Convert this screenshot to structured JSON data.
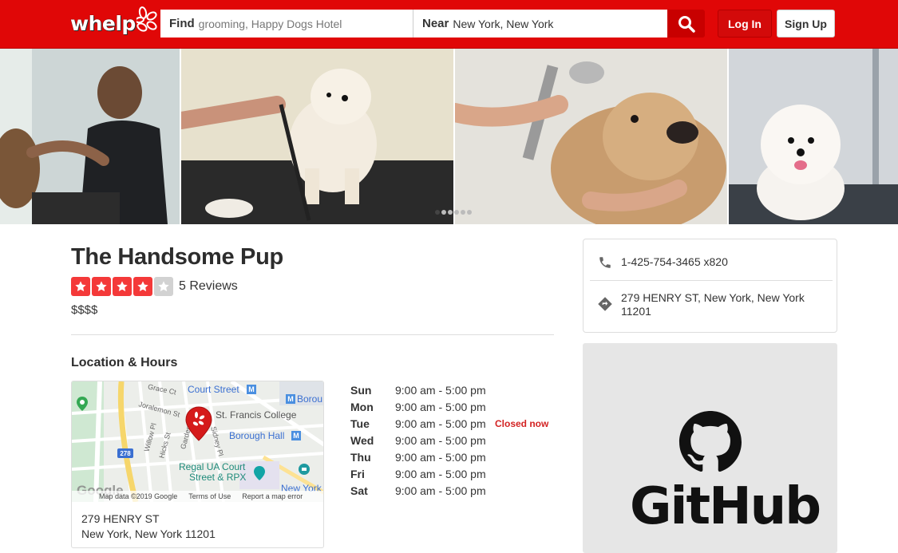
{
  "header": {
    "logo_text": "whelp",
    "search_find_label": "Find",
    "search_find_value": "grooming, Happy Dogs Hotel",
    "search_near_label": "Near",
    "search_near_value": "New York, New York",
    "login_label": "Log In",
    "signup_label": "Sign Up",
    "brand_color": "#e00707"
  },
  "business": {
    "name": "The Handsome Pup",
    "rating_stars": 4,
    "rating_max": 5,
    "reviews": "5 Reviews",
    "price": "$$$$"
  },
  "photos": {
    "count_shown": 4,
    "carousel_dots": 6,
    "active_dot": 0
  },
  "location": {
    "section_title": "Location & Hours",
    "map": {
      "labels": [
        "Court Street",
        "Borou",
        "St. Francis College",
        "Borough Hall",
        "Regal UA Court",
        "Street & RPX",
        "New York",
        "Grace Ct",
        "Joralemon St",
        "Willow Pl",
        "Hicks St",
        "Garden Pl",
        "Sidney Pl",
        "278"
      ],
      "google_logo": "Google",
      "footer_data": "Map data ©2019 Google",
      "footer_terms": "Terms of Use",
      "footer_report": "Report a map error"
    },
    "address_line1": "279 HENRY ST",
    "address_line2": "New York, New York 11201"
  },
  "hours": [
    {
      "day": "Sun",
      "time": "9:00 am - 5:00 pm",
      "status": ""
    },
    {
      "day": "Mon",
      "time": "9:00 am - 5:00 pm",
      "status": ""
    },
    {
      "day": "Tue",
      "time": "9:00 am - 5:00 pm",
      "status": "Closed now"
    },
    {
      "day": "Wed",
      "time": "9:00 am - 5:00 pm",
      "status": ""
    },
    {
      "day": "Thu",
      "time": "9:00 am - 5:00 pm",
      "status": ""
    },
    {
      "day": "Fri",
      "time": "9:00 am - 5:00 pm",
      "status": ""
    },
    {
      "day": "Sat",
      "time": "9:00 am - 5:00 pm",
      "status": ""
    }
  ],
  "contact": {
    "phone": "1-425-754-3465 x820",
    "address": "279 HENRY ST, New York, New York",
    "address_zip": "11201",
    "phone_icon": "phone-icon",
    "directions_icon": "directions-icon"
  },
  "sidebar_ad": {
    "text": "GitHub",
    "icon": "github-icon"
  }
}
